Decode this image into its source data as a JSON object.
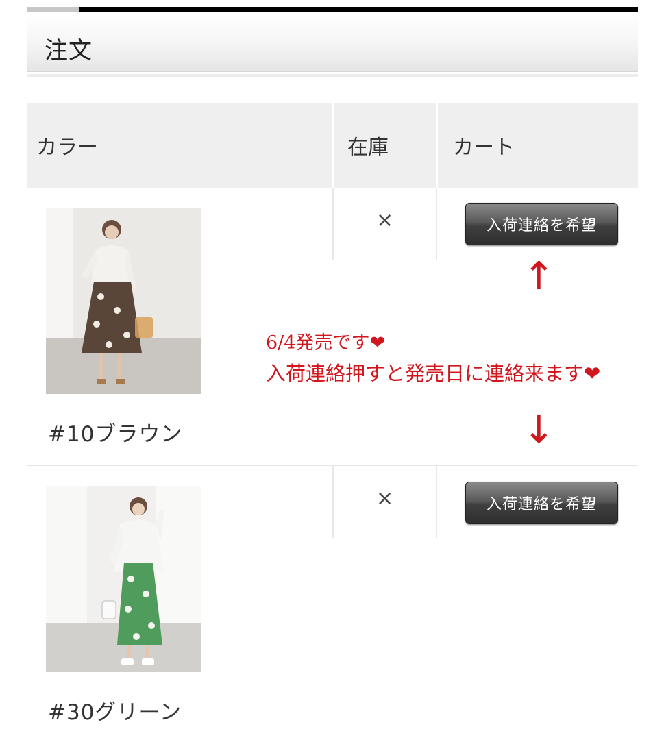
{
  "section": {
    "title": "注文"
  },
  "table": {
    "headers": {
      "color": "カラー",
      "stock": "在庫",
      "cart": "カート"
    },
    "rows": [
      {
        "color_name": "#10ブラウン",
        "stock": "×",
        "button_label": "入荷連絡を希望",
        "skirt_color": "#5a4638"
      },
      {
        "color_name": "#30グリーン",
        "stock": "×",
        "button_label": "入荷連絡を希望",
        "skirt_color": "#4f9c5c"
      }
    ]
  },
  "annotation": {
    "arrow_up": "↑",
    "arrow_down": "↓",
    "line1": "6/4発売です❤",
    "line2": "入荷連絡押すと発売日に連絡来ます❤",
    "color": "#d1161d"
  }
}
